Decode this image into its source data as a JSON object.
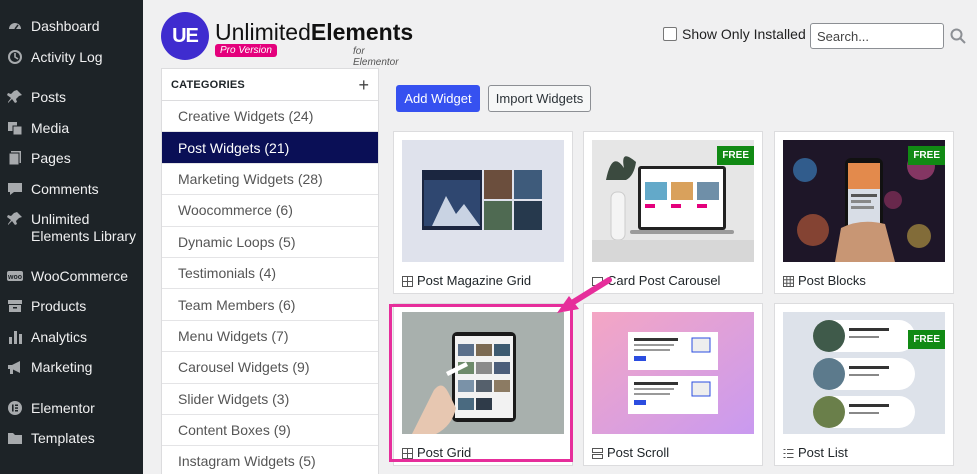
{
  "wp_menu": [
    {
      "label": "Dashboard",
      "icon": "dashboard-icon"
    },
    {
      "label": "Activity Log",
      "icon": "history-icon"
    },
    {
      "label": "Posts",
      "icon": "pin-icon"
    },
    {
      "label": "Media",
      "icon": "media-icon"
    },
    {
      "label": "Pages",
      "icon": "pages-icon"
    },
    {
      "label": "Comments",
      "icon": "comment-icon"
    },
    {
      "label": "Unlimited Elements Library",
      "icon": "pin-icon"
    },
    {
      "label": "WooCommerce",
      "icon": "woo-icon"
    },
    {
      "label": "Products",
      "icon": "archive-icon"
    },
    {
      "label": "Analytics",
      "icon": "bar-chart-icon"
    },
    {
      "label": "Marketing",
      "icon": "megaphone-icon"
    },
    {
      "label": "Elementor",
      "icon": "elementor-icon"
    },
    {
      "label": "Templates",
      "icon": "folder-icon"
    }
  ],
  "header": {
    "logo_mark": "UE",
    "logo_thin": "Unlimited",
    "logo_bold": "Elements",
    "badge": "Pro Version",
    "subtitle": "for Elementor",
    "show_installed_label": "Show Only Installed",
    "search_placeholder": "Search..."
  },
  "categories": {
    "title": "CATEGORIES",
    "add_symbol": "+",
    "items": [
      "Creative Widgets (24)",
      "Post Widgets (21)",
      "Marketing Widgets (28)",
      "Woocommerce (6)",
      "Dynamic Loops (5)",
      "Testimonials (4)",
      "Team Members (6)",
      "Menu Widgets (7)",
      "Carousel Widgets (9)",
      "Slider Widgets (3)",
      "Content Boxes (9)",
      "Instagram Widgets (5)"
    ],
    "active_index": 1
  },
  "toolbar": {
    "add_label": "Add Widget",
    "import_label": "Import Widgets"
  },
  "widgets": [
    {
      "name": "Post Magazine Grid",
      "free": false
    },
    {
      "name": "Card Post Carousel",
      "free": true
    },
    {
      "name": "Post Blocks",
      "free": true
    },
    {
      "name": "Post Grid",
      "free": false
    },
    {
      "name": "Post Scroll",
      "free": false
    },
    {
      "name": "Post List",
      "free": true
    }
  ],
  "free_label": "FREE",
  "colors": {
    "wp_sidebar": "#1d2327",
    "active_category": "#0a0f56",
    "primary_button": "#3651f0",
    "highlight": "#e62e9b",
    "free_badge": "#118a14"
  }
}
